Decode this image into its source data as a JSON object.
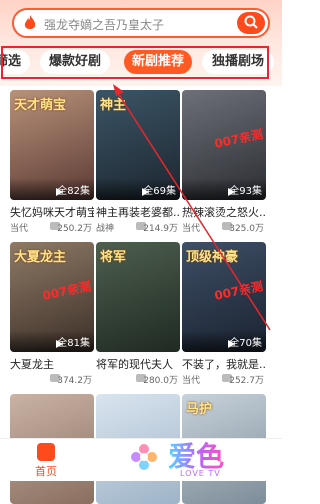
{
  "search": {
    "placeholder": "强龙夺嫡之吾乃皇太子"
  },
  "tabs": [
    {
      "label": "筛选"
    },
    {
      "label": "爆款好剧"
    },
    {
      "label": "新剧推荐"
    },
    {
      "label": "独播剧场"
    }
  ],
  "cards": [
    {
      "title": "失忆妈咪天才萌宝",
      "episodes": "全82集",
      "genre": "当代",
      "views": "250.2万",
      "poster_text": "天才萌宝",
      "watermark": "",
      "color_a": "#b8927a",
      "color_b": "#5b3a34"
    },
    {
      "title": "神主再装老婆都...",
      "episodes": "全69集",
      "genre": "战神",
      "views": "214.9万",
      "poster_text": "神主",
      "watermark": "",
      "color_a": "#3b5566",
      "color_b": "#1d2630"
    },
    {
      "title": "热辣滚烫之怒火...",
      "episodes": "全93集",
      "genre": "当代",
      "views": "325.0万",
      "poster_text": "",
      "watermark": "007亲测",
      "color_a": "#6d7077",
      "color_b": "#2b2d33"
    },
    {
      "title": "大夏龙主",
      "episodes": "全81集",
      "genre": "",
      "views": "374.2万",
      "poster_text": "大夏龙主",
      "watermark": "007亲测",
      "color_a": "#8e7a66",
      "color_b": "#3c2f28"
    },
    {
      "title": "将军的现代夫人",
      "episodes": "",
      "genre": "",
      "views": "280.0万",
      "poster_text": "将军",
      "watermark": "",
      "color_a": "#4e5f4f",
      "color_b": "#1f2a22"
    },
    {
      "title": "不装了，我就是...",
      "episodes": "全70集",
      "genre": "当代",
      "views": "252.7万",
      "poster_text": "顶级神豪",
      "watermark": "007亲测",
      "color_a": "#3e4f66",
      "color_b": "#1a2230"
    },
    {
      "title": "",
      "episodes": "",
      "genre": "",
      "views": "",
      "poster_text": "",
      "watermark": "",
      "color_a": "#c9b3a5",
      "color_b": "#8a6f60"
    },
    {
      "title": "",
      "episodes": "",
      "genre": "",
      "views": "",
      "poster_text": "",
      "watermark": "",
      "color_a": "#d9e4ef",
      "color_b": "#9fb4c8"
    },
    {
      "title": "",
      "episodes": "",
      "genre": "",
      "views": "",
      "poster_text": "马护",
      "watermark": "",
      "color_a": "#c8d2db",
      "color_b": "#7d8d99"
    }
  ],
  "bottom_nav": {
    "home_label": "首页"
  },
  "brand": {
    "name": "爱色",
    "sub": "LOVE TV"
  },
  "colors": {
    "accent": "#ff4a1c",
    "annotation": "#e8262c"
  }
}
